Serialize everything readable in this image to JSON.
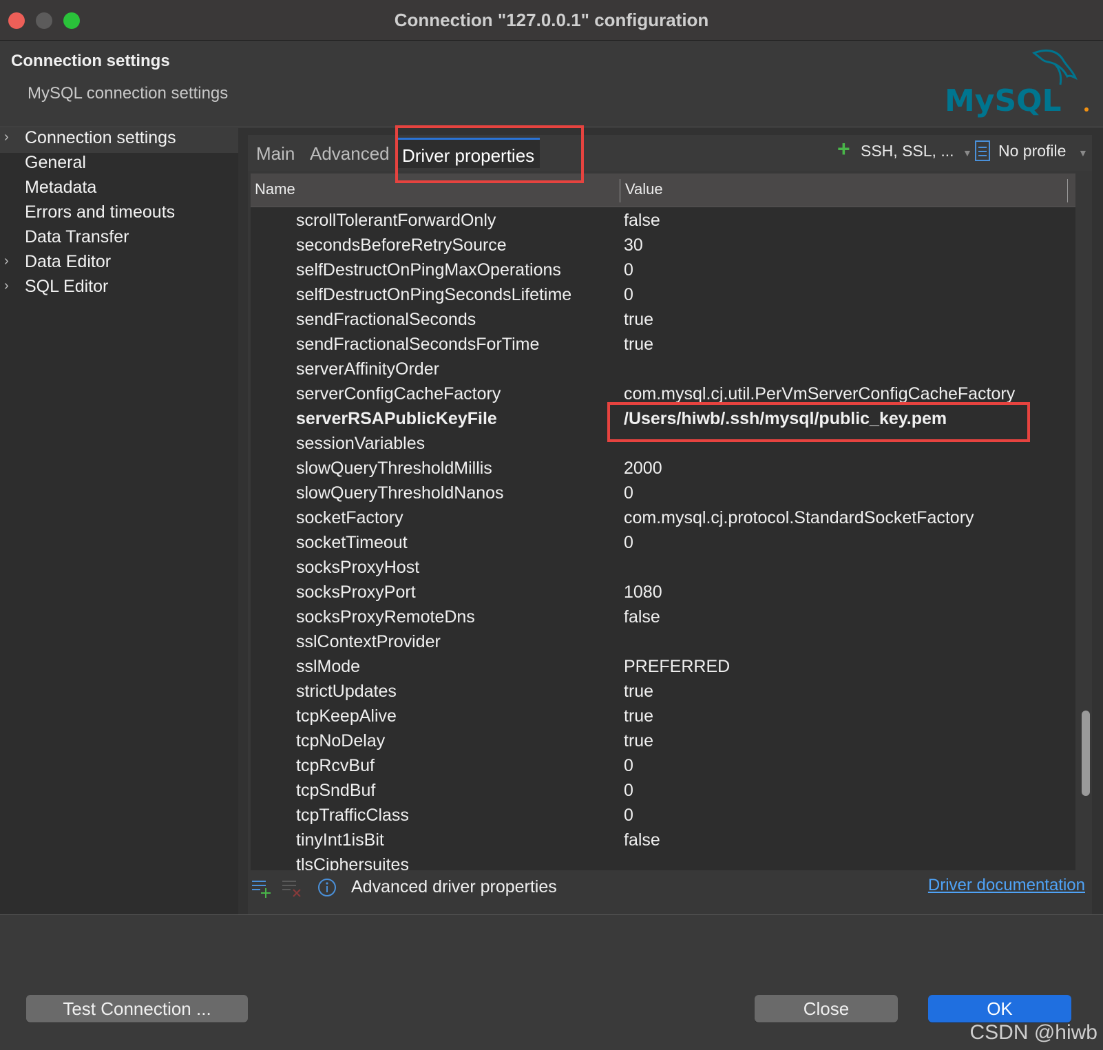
{
  "window": {
    "title": "Connection \"127.0.0.1\" configuration"
  },
  "header": {
    "title": "Connection settings",
    "subtitle": "MySQL connection settings",
    "logo_text": "MySQL"
  },
  "sidebar": {
    "items": [
      {
        "label": "Connection settings",
        "expandable": true,
        "selected": true
      },
      {
        "label": "General",
        "expandable": false
      },
      {
        "label": "Metadata",
        "expandable": false
      },
      {
        "label": "Errors and timeouts",
        "expandable": false
      },
      {
        "label": "Data Transfer",
        "expandable": false
      },
      {
        "label": "Data Editor",
        "expandable": true
      },
      {
        "label": "SQL Editor",
        "expandable": true
      }
    ]
  },
  "tabs": {
    "main": "Main",
    "advanced": "Advanced",
    "driver_properties": "Driver properties",
    "active": "Driver properties"
  },
  "toolbar": {
    "network_label": "SSH, SSL, ...",
    "profile_label": "No profile"
  },
  "table": {
    "columns": [
      "Name",
      "Value"
    ],
    "rows": [
      {
        "name": "scrollTolerantForwardOnly",
        "value": "false"
      },
      {
        "name": "secondsBeforeRetrySource",
        "value": "30"
      },
      {
        "name": "selfDestructOnPingMaxOperations",
        "value": "0"
      },
      {
        "name": "selfDestructOnPingSecondsLifetime",
        "value": "0"
      },
      {
        "name": "sendFractionalSeconds",
        "value": "true"
      },
      {
        "name": "sendFractionalSecondsForTime",
        "value": "true"
      },
      {
        "name": "serverAffinityOrder",
        "value": ""
      },
      {
        "name": "serverConfigCacheFactory",
        "value": "com.mysql.cj.util.PerVmServerConfigCacheFactory"
      },
      {
        "name": "serverRSAPublicKeyFile",
        "value": "/Users/hiwb/.ssh/mysql/public_key.pem",
        "bold": true
      },
      {
        "name": "sessionVariables",
        "value": ""
      },
      {
        "name": "slowQueryThresholdMillis",
        "value": "2000"
      },
      {
        "name": "slowQueryThresholdNanos",
        "value": "0"
      },
      {
        "name": "socketFactory",
        "value": "com.mysql.cj.protocol.StandardSocketFactory"
      },
      {
        "name": "socketTimeout",
        "value": "0"
      },
      {
        "name": "socksProxyHost",
        "value": ""
      },
      {
        "name": "socksProxyPort",
        "value": "1080"
      },
      {
        "name": "socksProxyRemoteDns",
        "value": "false"
      },
      {
        "name": "sslContextProvider",
        "value": ""
      },
      {
        "name": "sslMode",
        "value": "PREFERRED"
      },
      {
        "name": "strictUpdates",
        "value": "true"
      },
      {
        "name": "tcpKeepAlive",
        "value": "true"
      },
      {
        "name": "tcpNoDelay",
        "value": "true"
      },
      {
        "name": "tcpRcvBuf",
        "value": "0"
      },
      {
        "name": "tcpSndBuf",
        "value": "0"
      },
      {
        "name": "tcpTrafficClass",
        "value": "0"
      },
      {
        "name": "tinyInt1isBit",
        "value": "false"
      },
      {
        "name": "tlsCiphersuites",
        "value": ""
      }
    ]
  },
  "panel_footer": {
    "info_text": "Advanced driver properties",
    "link_text": "Driver documentation"
  },
  "buttons": {
    "test_connection": "Test Connection ...",
    "close": "Close",
    "ok": "OK"
  },
  "watermark": "CSDN @hiwb",
  "colors": {
    "accent_blue": "#1f6fe0",
    "highlight_red": "#e6433f",
    "link_blue": "#4fa3f7",
    "logo_teal": "#00758f",
    "logo_orange": "#f29111"
  }
}
